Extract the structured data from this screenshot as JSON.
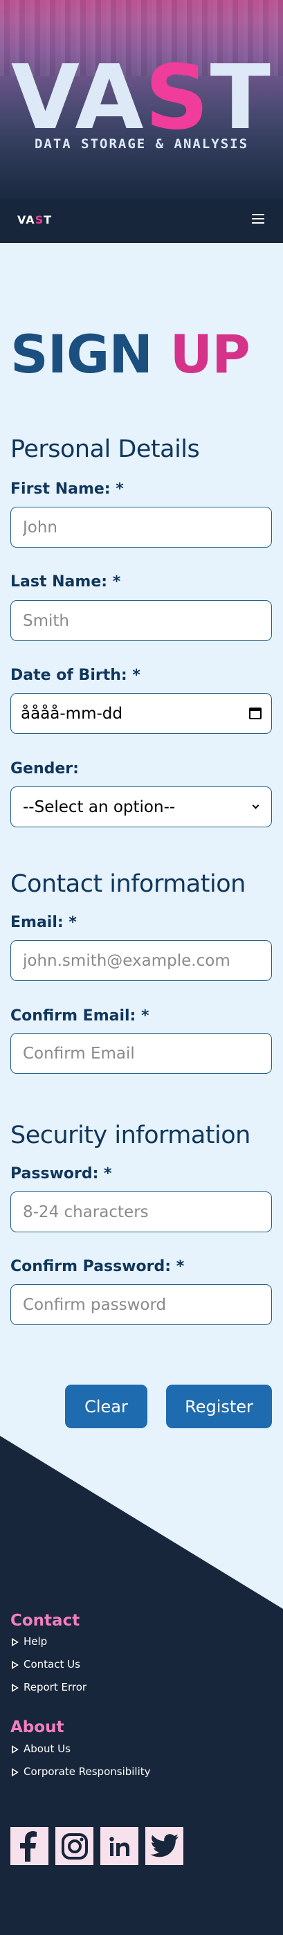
{
  "hero": {
    "brand_prefix": "VA",
    "brand_accent": "S",
    "brand_suffix": "T",
    "tagline": "DATA STORAGE & ANALYSIS"
  },
  "navbar": {
    "logo_prefix": "VA",
    "logo_accent": "S",
    "logo_suffix": "T",
    "menu_icon": "hamburger-menu-icon"
  },
  "form": {
    "title_part1": "SIGN",
    "title_part2": "UP",
    "personal": {
      "heading": "Personal Details",
      "first_name_label": "First Name: *",
      "first_name_placeholder": "John",
      "last_name_label": "Last Name: *",
      "last_name_placeholder": "Smith",
      "dob_label": "Date of Birth: *",
      "dob_value": "åååå-mm-dd",
      "gender_label": "Gender:",
      "gender_selected": "--Select an option--"
    },
    "contact": {
      "heading": "Contact information",
      "email_label": "Email: *",
      "email_placeholder": "john.smith@example.com",
      "confirm_email_label": "Confirm Email: *",
      "confirm_email_placeholder": "Confirm Email"
    },
    "security": {
      "heading": "Security information",
      "password_label": "Password: *",
      "password_placeholder": "8-24 characters",
      "confirm_password_label": "Confirm Password: *",
      "confirm_password_placeholder": "Confirm password"
    },
    "buttons": {
      "clear": "Clear",
      "register": "Register"
    }
  },
  "footer": {
    "contact_title": "Contact",
    "contact_links": [
      "Help",
      "Contact Us",
      "Report Error"
    ],
    "about_title": "About",
    "about_links": [
      "About Us",
      "Corporate Responsibility"
    ],
    "social_icons": [
      "facebook-icon",
      "instagram-icon",
      "linkedin-icon",
      "twitter-icon"
    ]
  },
  "colors": {
    "accent_pink": "#f03c9a",
    "primary_blue": "#1f6bb0",
    "page_bg": "#e6f3fd",
    "footer_bg": "#17263a",
    "heading_navy": "#10365c"
  }
}
